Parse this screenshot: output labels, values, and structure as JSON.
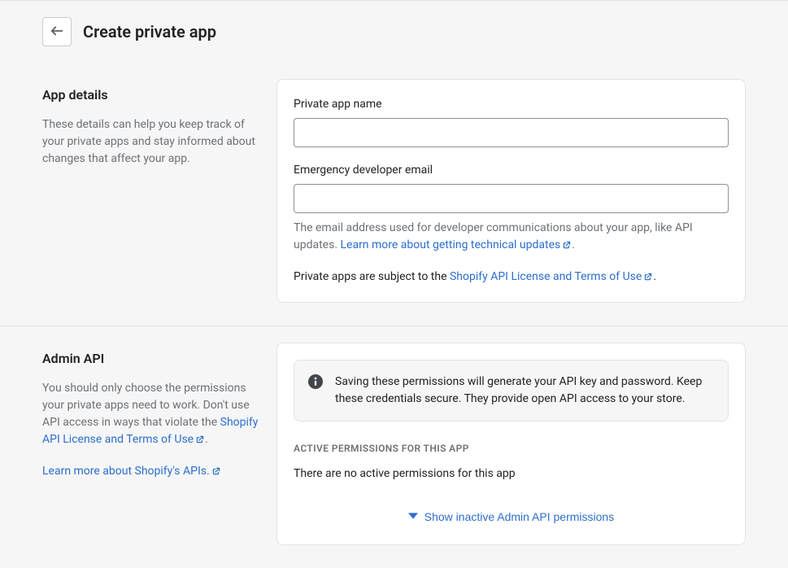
{
  "header": {
    "title": "Create private app"
  },
  "sections": {
    "appDetails": {
      "heading": "App details",
      "description": "These details can help you keep track of your private apps and stay informed about changes that affect your app.",
      "fields": {
        "nameLabel": "Private app name",
        "nameValue": "",
        "emailLabel": "Emergency developer email",
        "emailValue": "",
        "emailHelpPrefix": "The email address used for developer communications about your app, like API updates. ",
        "emailHelpLink": "Learn more about getting technical updates"
      },
      "legalPrefix": "Private apps are subject to the ",
      "legalLink": "Shopify API License and Terms of Use"
    },
    "adminApi": {
      "heading": "Admin API",
      "descriptionPrefix": "You should only choose the permissions your private apps need to work. Don't use API access in ways that violate the ",
      "descriptionLink": "Shopify API License and Terms of Use",
      "learnMoreLink": "Learn more about Shopify's APIs.",
      "bannerText": "Saving these permissions will generate your API key and password. Keep these credentials secure. They provide open API access to your store.",
      "activeHeading": "Active permissions for this app",
      "emptyText": "There are no active permissions for this app",
      "disclosureLabel": "Show inactive Admin API permissions"
    }
  }
}
